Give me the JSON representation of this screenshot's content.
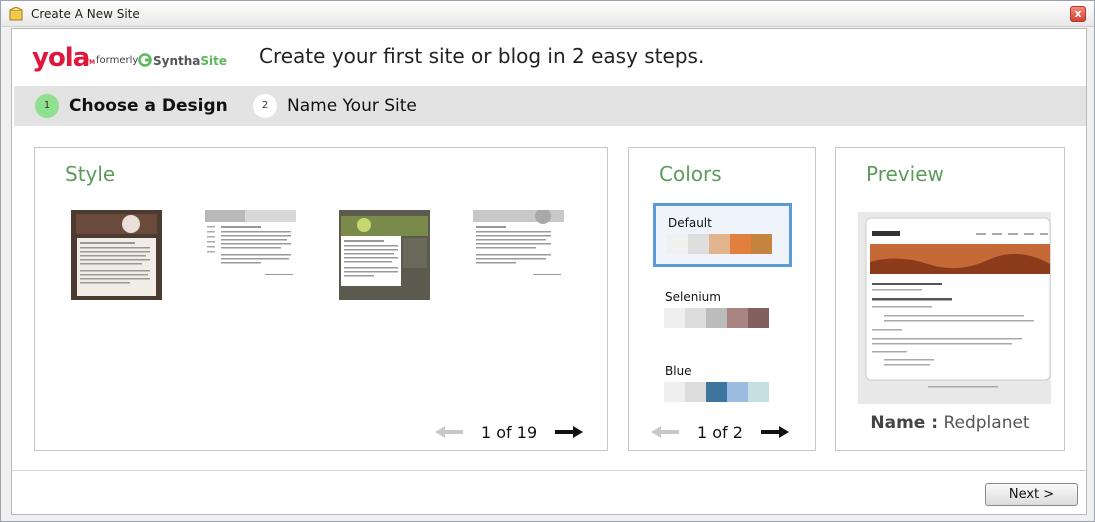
{
  "window": {
    "title": "Create A New Site",
    "close_label": "x"
  },
  "logo": {
    "brand": "yola",
    "tm": "TM",
    "formerly": "formerly",
    "synth": "Syntha",
    "site": "Site"
  },
  "headline": "Create your first site or blog in 2 easy steps.",
  "steps": [
    {
      "num": "1",
      "label": "Choose a Design"
    },
    {
      "num": "2",
      "label": "Name Your Site"
    }
  ],
  "style_panel": {
    "title": "Style",
    "pager": "1 of 19"
  },
  "colors_panel": {
    "title": "Colors",
    "pager": "1 of 2",
    "options": [
      {
        "name": "Default",
        "swatches": [
          "#f0f0f0",
          "#dedede",
          "#e2b48e",
          "#e0803c",
          "#c4843e"
        ]
      },
      {
        "name": "Selenium",
        "swatches": [
          "#efefef",
          "#dcdcdc",
          "#bcbcbc",
          "#a98380",
          "#82605d"
        ]
      },
      {
        "name": "Blue",
        "swatches": [
          "#efefef",
          "#dcdcdc",
          "#3e76a0",
          "#9bbbe0",
          "#c4e0e2"
        ]
      }
    ]
  },
  "preview_panel": {
    "title": "Preview",
    "name_label": "Name :",
    "name_value": "Redplanet"
  },
  "footer": {
    "next_label": "Next >"
  }
}
